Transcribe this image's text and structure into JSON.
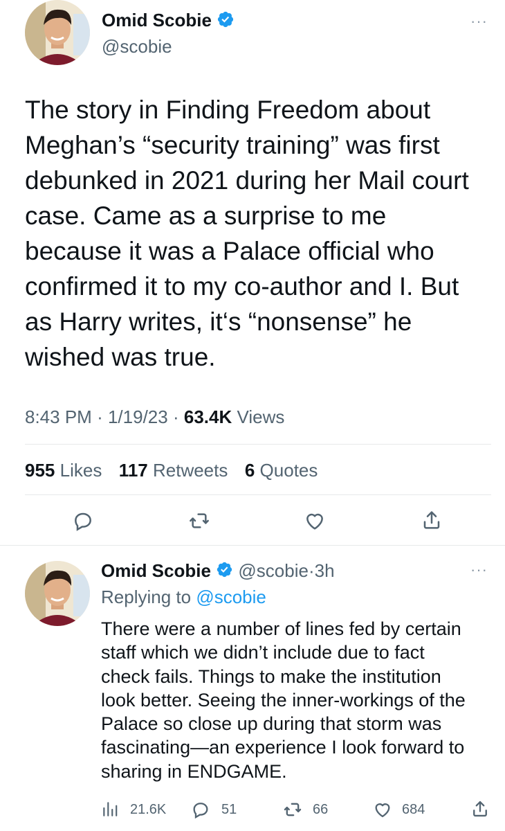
{
  "main_tweet": {
    "author": {
      "name": "Omid Scobie",
      "handle": "@scobie"
    },
    "more_glyph": "···",
    "text_lines": [
      "The story in Finding Freedom about",
      "Meghan’s “security training” was first",
      "debunked in 2021 during her Mail court",
      "case. Came as a surprise to me",
      "because it was a Palace official who",
      "confirmed it to my co-author and I. But",
      "as Harry writes, it‘s  “nonsense” he",
      "wished was true."
    ],
    "time": "8:43 PM",
    "date": "1/19/23",
    "sep": "·",
    "views_count": "63.4K",
    "views_label": "Views",
    "stats": {
      "likes_count": "955",
      "likes_label": "Likes",
      "retweets_count": "117",
      "retweets_label": "Retweets",
      "quotes_count": "6",
      "quotes_label": "Quotes"
    },
    "actions": [
      "reply-icon",
      "retweet-icon",
      "like-icon",
      "share-icon"
    ]
  },
  "reply_tweet": {
    "author": {
      "name": "Omid Scobie",
      "handle": "@scobie",
      "time": "3h"
    },
    "sep": "·",
    "more_glyph": "···",
    "replying_prefix": "Replying to",
    "replying_handle": "@scobie",
    "text_lines": [
      "There were a number of lines fed by certain",
      "staff which we didn’t include due to fact",
      "check fails. Things to make the institution",
      "look better. Seeing the inner-workings of the",
      "Palace so close up during that storm was",
      "fascinating—an experience I look forward to",
      "sharing in ENDGAME."
    ],
    "metrics": {
      "views": "21.6K",
      "replies": "51",
      "retweets": "66",
      "likes": "684"
    }
  },
  "colors": {
    "text": "#0f1419",
    "muted": "#536471",
    "link": "#1d9bf0",
    "verified": "#1d9bf0",
    "divider": "#e7e9ea"
  }
}
